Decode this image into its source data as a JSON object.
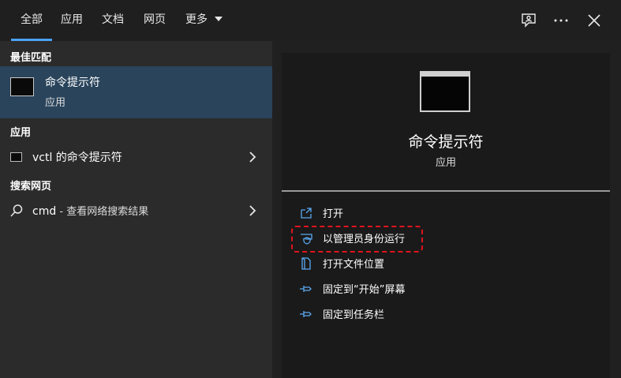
{
  "tabs": [
    {
      "label": "全部",
      "active": true
    },
    {
      "label": "应用"
    },
    {
      "label": "文档"
    },
    {
      "label": "网页"
    },
    {
      "label": "更多"
    }
  ],
  "toolbar_icons": [
    "feedback-icon",
    "more-options-icon",
    "close-icon"
  ],
  "left": {
    "best_match_heading": "最佳匹配",
    "best_match": {
      "title": "命令提示符",
      "subtitle": "应用"
    },
    "apps_heading": "应用",
    "apps": [
      {
        "label": "vctl 的命令提示符"
      }
    ],
    "web_heading": "搜索网页",
    "web": [
      {
        "label": "cmd",
        "sub": " - 查看网络搜索结果"
      }
    ]
  },
  "right": {
    "title": "命令提示符",
    "subtitle": "应用",
    "actions": [
      {
        "label": "打开",
        "icon": "open-icon"
      },
      {
        "label": "以管理员身份运行",
        "icon": "admin-shield-icon"
      },
      {
        "label": "打开文件位置",
        "icon": "file-location-icon"
      },
      {
        "label": "固定到“开始”屏幕",
        "icon": "pin-icon"
      },
      {
        "label": "固定到任务栏",
        "icon": "pin-icon"
      }
    ]
  },
  "colors": {
    "accent": "#4aa3f5",
    "selected": "#29445b",
    "highlight": "#e0141e"
  }
}
